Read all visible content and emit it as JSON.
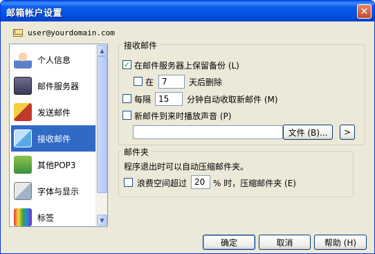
{
  "window": {
    "title": "邮箱帐户设置",
    "close_label": "✕"
  },
  "account": {
    "email": "user@yourdomain.com"
  },
  "sidebar": {
    "items": [
      {
        "label": "个人信息",
        "icon": "person-icon",
        "color": "#D9A441"
      },
      {
        "label": "邮件服务器",
        "icon": "server-icon",
        "color": "#4A4A6A"
      },
      {
        "label": "发送邮件",
        "icon": "send-icon",
        "color": "#C0392B"
      },
      {
        "label": "接收邮件",
        "icon": "receive-icon",
        "color": "#5AA9E6",
        "selected": true
      },
      {
        "label": "其他POP3",
        "icon": "pop3-icon",
        "color": "#3E8E41"
      },
      {
        "label": "字体与显示",
        "icon": "font-icon",
        "color": "#6C7A89"
      },
      {
        "label": "标签",
        "icon": "tag-icon",
        "color": "#C2185B"
      }
    ]
  },
  "receive_group": {
    "title": "接收邮件",
    "keep_backup_label": "在邮件服务器上保留备份 (L)",
    "keep_backup_checked": true,
    "delete_after_prefix": "在",
    "delete_after_value": "7",
    "delete_after_suffix": "天后删除",
    "delete_after_checked": false,
    "every_label": "每隔",
    "every_value": "15",
    "every_suffix": "分钟自动收取新邮件 (M)",
    "every_checked": false,
    "sound_label": "新邮件到来时播放声音 (P)",
    "sound_checked": false,
    "sound_path": "",
    "file_button": "文件 (B)...",
    "play_button": ">"
  },
  "folder_group": {
    "title": "邮件夹",
    "description": "程序退出时可以自动压缩邮件夹。",
    "compress_label": "浪费空间超过",
    "compress_value": "20",
    "compress_suffix": "% 时，压缩邮件夹 (E)",
    "compress_checked": false
  },
  "footer": {
    "ok": "确定",
    "cancel": "取消",
    "help": "帮助 (H)"
  }
}
